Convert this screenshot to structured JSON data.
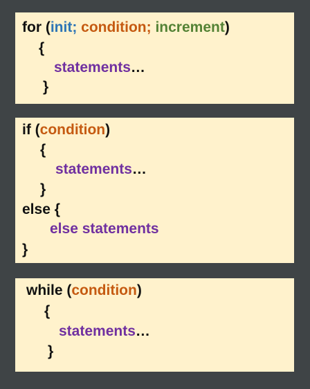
{
  "colors": {
    "background": "#3f4446",
    "box_fill": "#fff2cc",
    "keyword": "#111111",
    "init": "#2e75b6",
    "condition": "#c55a11",
    "increment": "#548235",
    "statements": "#7030a0"
  },
  "for_block": {
    "keyword": "for (",
    "init": "init;",
    "condition": " condition;",
    "increment": " increment",
    "close_paren": ")",
    "open_brace": "{",
    "statements": "statements",
    "ellipsis": "…",
    "close_brace": "}"
  },
  "if_block": {
    "keyword": "if (",
    "condition": "condition",
    "close_paren": ")",
    "open_brace": "{",
    "statements": "statements",
    "ellipsis": "…",
    "close_brace": "}",
    "else_open": "else {",
    "else_statements": "else statements",
    "else_close": "}"
  },
  "while_block": {
    "keyword": "while (",
    "condition": "condition",
    "close_paren": ")",
    "open_brace": "{",
    "statements": "statements",
    "ellipsis": "…",
    "close_brace": "}"
  }
}
